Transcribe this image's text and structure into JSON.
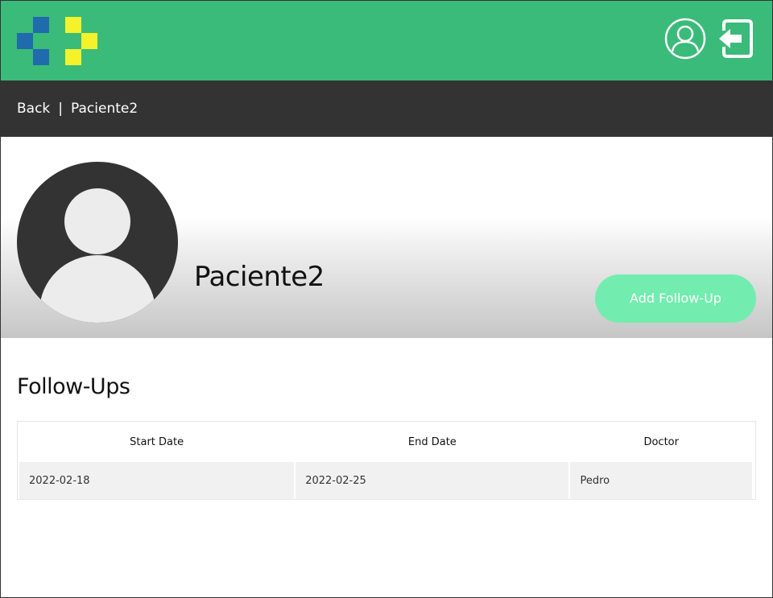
{
  "colors": {
    "header_green": "#3abb7a",
    "dark_bar": "#333333",
    "button_green": "#72edaf",
    "logo_blue": "#1f6bab",
    "logo_yellow": "#f4f22a"
  },
  "header": {
    "logo_icon": "medical-cross-logo",
    "profile_icon": "user-circle-icon",
    "logout_icon": "logout-icon"
  },
  "breadcrumb": {
    "back_label": "Back",
    "separator": "|",
    "current": "Paciente2"
  },
  "profile": {
    "avatar_icon": "user-avatar-icon",
    "name": "Paciente2",
    "add_button_label": "Add Follow-Up"
  },
  "followups": {
    "title": "Follow-Ups",
    "columns": [
      "Start Date",
      "End Date",
      "Doctor"
    ],
    "rows": [
      [
        "2022-02-18",
        "2022-02-25",
        "Pedro"
      ]
    ]
  }
}
